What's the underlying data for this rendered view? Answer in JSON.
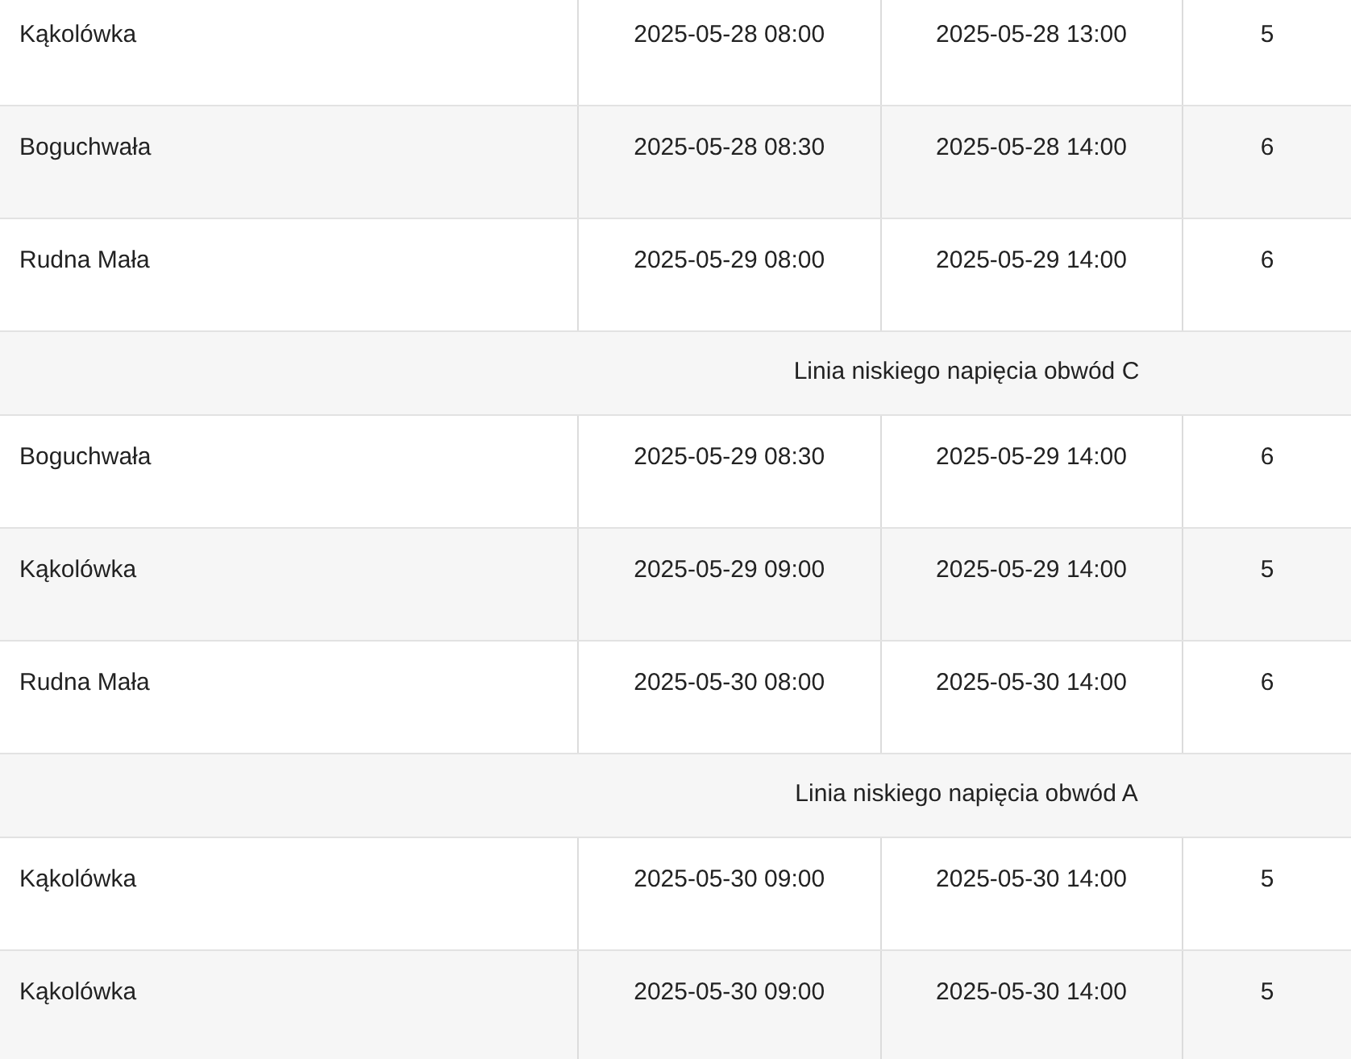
{
  "rows": [
    {
      "kind": "entry",
      "place": "Kąkolówka",
      "start": "2025-05-28 08:00",
      "end": "2025-05-28 13:00",
      "column_4": "5"
    },
    {
      "kind": "entry",
      "place": "Boguchwała",
      "start": "2025-05-28 08:30",
      "end": "2025-05-28 14:00",
      "column_4": "6"
    },
    {
      "kind": "entry",
      "place": "Rudna Mała",
      "start": "2025-05-29 08:00",
      "end": "2025-05-29 14:00",
      "column_4": "6"
    },
    {
      "kind": "group",
      "title": "Linia niskiego napięcia obwód C"
    },
    {
      "kind": "entry",
      "place": "Boguchwała",
      "start": "2025-05-29 08:30",
      "end": "2025-05-29 14:00",
      "column_4": "6"
    },
    {
      "kind": "entry",
      "place": "Kąkolówka",
      "start": "2025-05-29 09:00",
      "end": "2025-05-29 14:00",
      "column_4": "5"
    },
    {
      "kind": "entry",
      "place": "Rudna Mała",
      "start": "2025-05-30 08:00",
      "end": "2025-05-30 14:00",
      "column_4": "6"
    },
    {
      "kind": "group",
      "title": "Linia niskiego napięcia obwód A"
    },
    {
      "kind": "entry",
      "place": "Kąkolówka",
      "start": "2025-05-30 09:00",
      "end": "2025-05-30 14:00",
      "column_4": "5"
    },
    {
      "kind": "entry",
      "place": "Kąkolówka",
      "start": "2025-05-30 09:00",
      "end": "2025-05-30 14:00",
      "column_4": "5"
    }
  ]
}
